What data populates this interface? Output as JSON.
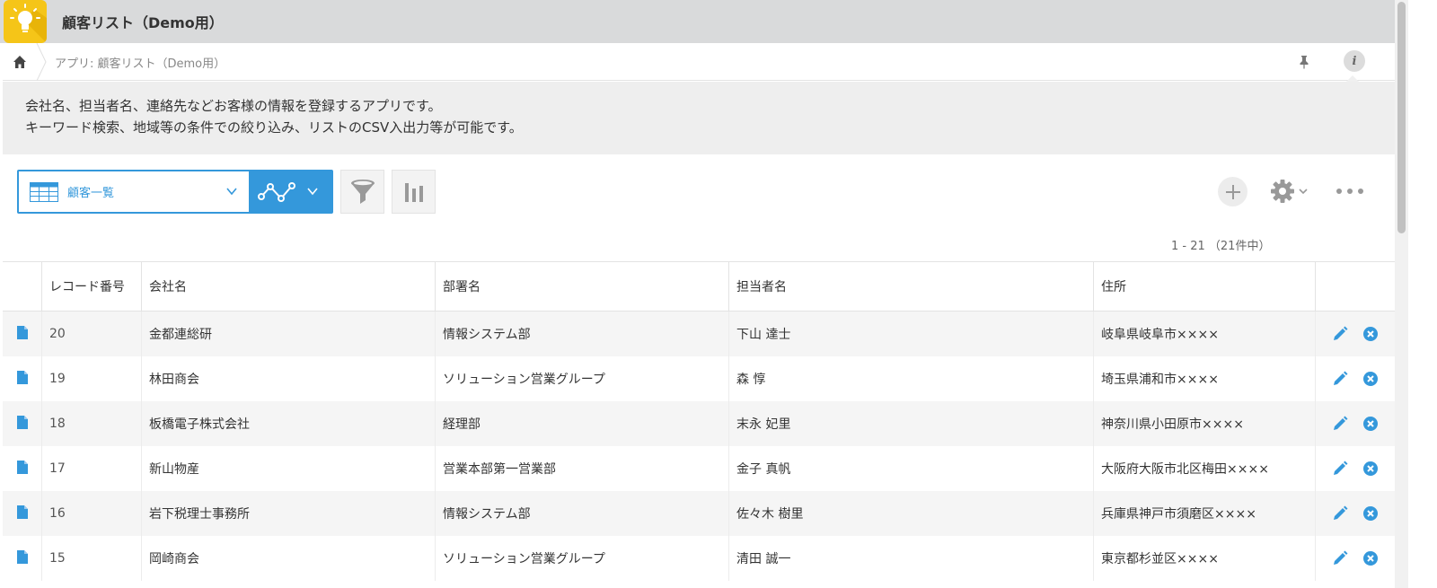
{
  "app": {
    "title": "顧客リスト（Demo用）",
    "breadcrumb": "アプリ: 顧客リスト（Demo用）",
    "info_label": "i"
  },
  "description": {
    "line1": "会社名、担当者名、連絡先などお客様の情報を登録するアプリです。",
    "line2": "キーワード検索、地域等の条件での絞り込み、リストのCSV入出力等が可能です。"
  },
  "toolbar": {
    "view_label": "顧客一覧"
  },
  "pager": {
    "text": "1 - 21 （21件中）"
  },
  "table": {
    "headers": [
      "レコード番号",
      "会社名",
      "部署名",
      "担当者名",
      "住所"
    ],
    "rows": [
      {
        "no": "20",
        "company": "金都連総研",
        "dept": "情報システム部",
        "contact": "下山 達士",
        "address": "岐阜県岐阜市××××"
      },
      {
        "no": "19",
        "company": "林田商会",
        "dept": "ソリューション営業グループ",
        "contact": "森 惇",
        "address": "埼玉県浦和市××××"
      },
      {
        "no": "18",
        "company": "板橋電子株式会社",
        "dept": "経理部",
        "contact": "末永 妃里",
        "address": "神奈川県小田原市××××"
      },
      {
        "no": "17",
        "company": "新山物産",
        "dept": "営業本部第一営業部",
        "contact": "金子 真帆",
        "address": "大阪府大阪市北区梅田××××"
      },
      {
        "no": "16",
        "company": "岩下税理士事務所",
        "dept": "情報システム部",
        "contact": "佐々木 樹里",
        "address": "兵庫県神戸市須磨区××××"
      },
      {
        "no": "15",
        "company": "岡崎商会",
        "dept": "ソリューション営業グループ",
        "contact": "清田 誠一",
        "address": "東京都杉並区××××"
      }
    ]
  },
  "colors": {
    "accent": "#3498db",
    "header_bg": "#d9dadb",
    "app_icon": "#f5c518"
  },
  "icons": [
    "lightbulb-icon",
    "home-icon",
    "pin-icon",
    "info-icon",
    "table-view-icon",
    "graph-icon",
    "filter-icon",
    "bar-chart-icon",
    "plus-icon",
    "gear-icon",
    "more-icon",
    "document-icon",
    "edit-icon",
    "delete-icon"
  ]
}
